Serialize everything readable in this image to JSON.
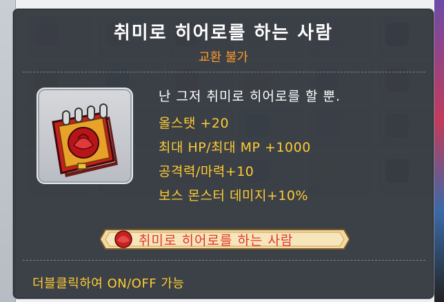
{
  "tooltip": {
    "title": "취미로 히어로를 하는 사람",
    "subtitle": "교환 불가",
    "description": "난 그저 취미로 히어로를 할 뿐.",
    "stats": [
      "올스탯 +20",
      "최대 HP/최대 MP +1000",
      "공격력/마력+10",
      "보스 몬스터 데미지+10%"
    ],
    "medal_label": "취미로 히어로를 하는 사람",
    "footer": "더블클릭하여 ON/OFF 가능",
    "icon": "hero-notebook-icon"
  },
  "background": {
    "slot_count": "1"
  },
  "colors": {
    "title": "#ffffff",
    "subtitle": "#ff9a2a",
    "stats": "#ffcc33",
    "tooltip_bg": "#32373e",
    "medal_text": "#e3342a"
  }
}
